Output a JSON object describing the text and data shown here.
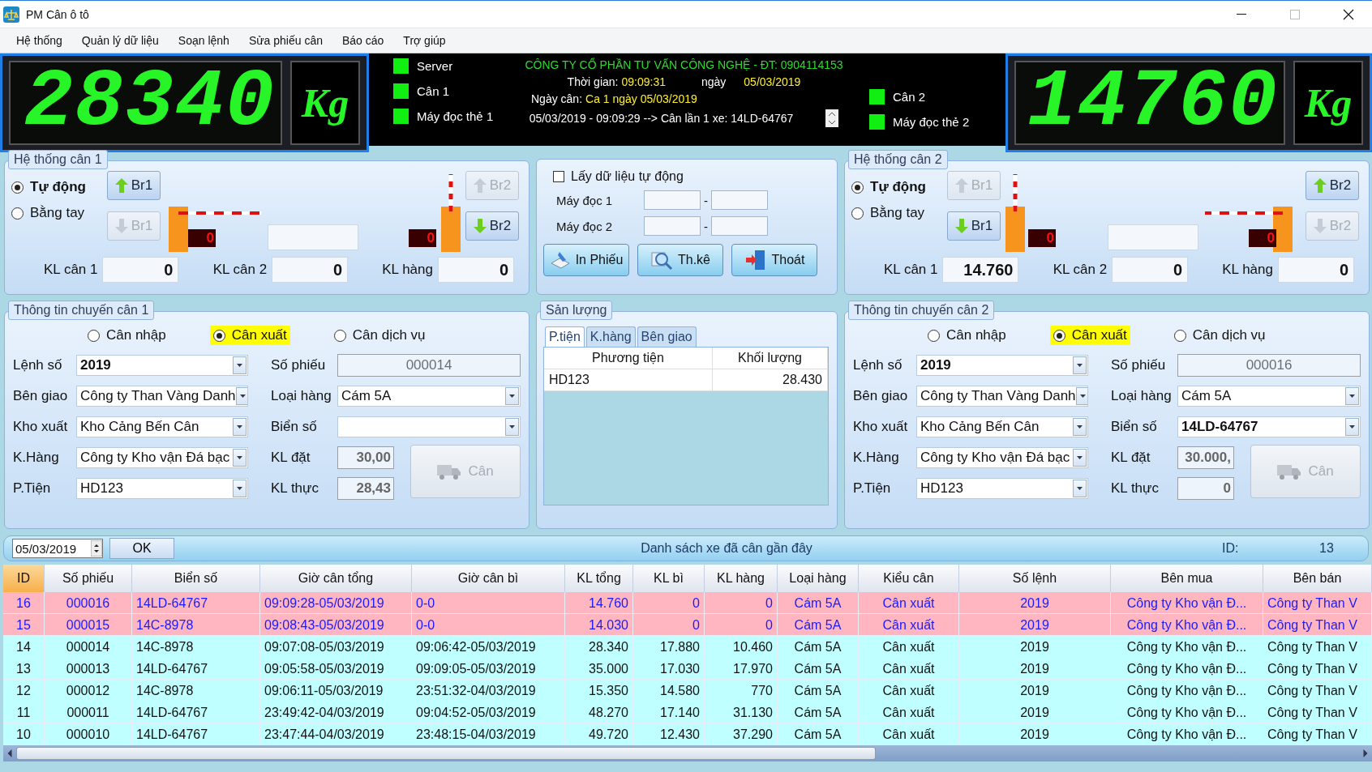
{
  "window": {
    "title": "PM Cân ô tô"
  },
  "menu": [
    {
      "label": "Hệ thống"
    },
    {
      "label": "Quản lý dữ liệu"
    },
    {
      "label": "Soạn lệnh"
    },
    {
      "label": "Sửa phiếu cân"
    },
    {
      "label": "Báo cáo"
    },
    {
      "label": "Trợ giúp"
    }
  ],
  "displays": [
    {
      "reading": "28340",
      "unit": "Kg"
    },
    {
      "reading": "14760",
      "unit": "Kg"
    }
  ],
  "status": {
    "indicators": [
      {
        "label": "Server",
        "on": true
      },
      {
        "label": "Cân 1",
        "on": true
      },
      {
        "label": "Máy đọc thẻ 1",
        "on": true
      },
      {
        "label": "Cân 2",
        "on": true
      },
      {
        "label": "Máy đọc thẻ 2",
        "on": true
      }
    ],
    "company": "CÔNG TY CỔ PHẦN TƯ VẤN CÔNG NGHỆ - ĐT: 0904114153",
    "time": {
      "label": "Thời gian:",
      "value": "09:09:31"
    },
    "day": {
      "label": "ngày",
      "value": "05/03/2019"
    },
    "weigh_date": {
      "label": "Ngày cân:",
      "value": "Ca 1 ngày 05/03/2019"
    },
    "log": "05/03/2019 - 09:09:29 --> Cân lần 1 xe: 14LD-64767"
  },
  "scales": [
    {
      "title": "Hệ thống cân 1",
      "modes": [
        {
          "label": "Tự động",
          "selected": true
        },
        {
          "label": "Bằng tay",
          "selected": false
        }
      ],
      "gates": [
        {
          "buttons": [
            {
              "label": "Br1",
              "kind": "up",
              "disabled": false
            },
            {
              "label": "Br1",
              "kind": "down",
              "disabled": true
            }
          ],
          "open": false,
          "counter": "0"
        },
        {
          "buttons": [
            {
              "label": "Br2",
              "kind": "up",
              "disabled": true
            },
            {
              "label": "Br2",
              "kind": "down",
              "disabled": false
            }
          ],
          "open": true,
          "counter": "0"
        }
      ],
      "weights": [
        {
          "label": "KL cân 1",
          "value": "0"
        },
        {
          "label": "KL cân 2",
          "value": "0"
        },
        {
          "label": "KL hàng",
          "value": "0"
        }
      ]
    },
    {
      "title": "Hệ thống cân 2",
      "modes": [
        {
          "label": "Tự động",
          "selected": true
        },
        {
          "label": "Bằng tay",
          "selected": false
        }
      ],
      "gates": [
        {
          "buttons": [
            {
              "label": "Br1",
              "kind": "up",
              "disabled": true
            },
            {
              "label": "Br1",
              "kind": "down",
              "disabled": false
            }
          ],
          "open": true,
          "counter": "0"
        },
        {
          "buttons": [
            {
              "label": "Br2",
              "kind": "up",
              "disabled": false
            },
            {
              "label": "Br2",
              "kind": "down",
              "disabled": true
            }
          ],
          "open": false,
          "counter": "0"
        }
      ],
      "weights": [
        {
          "label": "KL cân 1",
          "value": "14.760"
        },
        {
          "label": "KL cân 2",
          "value": "0"
        },
        {
          "label": "KL hàng",
          "value": "0"
        }
      ]
    }
  ],
  "reader_box": {
    "auto": {
      "label": "Lấy dữ liệu tự động",
      "checked": false
    },
    "readers": [
      {
        "label": "Máy đọc 1",
        "separator": "-"
      },
      {
        "label": "Máy đọc 2",
        "separator": "-"
      }
    ],
    "actions": [
      {
        "label": "In Phiếu",
        "kind": "print"
      },
      {
        "label": "Th.kê",
        "kind": "stats"
      },
      {
        "label": "Thoát",
        "kind": "exit"
      }
    ]
  },
  "output": {
    "title": "Sản lượng",
    "tabs": [
      {
        "label": "P.tiện",
        "selected": true
      },
      {
        "label": "K.hàng",
        "selected": false
      },
      {
        "label": "Bên giao",
        "selected": false
      }
    ],
    "columns": [
      "Phương tiện",
      "Khối lượng"
    ],
    "rows": [
      [
        "HD123",
        "28.430"
      ]
    ]
  },
  "trips": [
    {
      "title": "Thông tin chuyến cân 1",
      "types": [
        {
          "label": "Cân nhập",
          "selected": false
        },
        {
          "label": "Cân xuất",
          "selected": true
        },
        {
          "label": "Cân dịch vụ",
          "selected": false
        }
      ],
      "left_fields": [
        {
          "label": "Lệnh số",
          "value": "2019"
        },
        {
          "label": "Bên giao",
          "value": "Công ty Than Vàng Danh"
        },
        {
          "label": "Kho xuất",
          "value": "Kho Cảng Bến Cân"
        },
        {
          "label": "K.Hàng",
          "value": "Công ty Kho vận Đá bạc"
        },
        {
          "label": "P.Tiện",
          "value": "HD123"
        }
      ],
      "right_fields": [
        {
          "label": "Số phiếu",
          "value": "000014",
          "kind": "readonly"
        },
        {
          "label": "Loại hàng",
          "value": "Cám 5A",
          "kind": "combo"
        },
        {
          "label": "Biển số",
          "kind": "combo"
        },
        {
          "label": "KL đặt",
          "value": "30,00",
          "kind": "number"
        },
        {
          "label": "KL thực",
          "value": "28,43",
          "kind": "number"
        }
      ],
      "weigh_button": {
        "label": "Cân",
        "disabled": true
      }
    },
    {
      "title": "Thông tin chuyến cân 2",
      "types": [
        {
          "label": "Cân nhập",
          "selected": false
        },
        {
          "label": "Cân xuất",
          "selected": true
        },
        {
          "label": "Cân dịch vụ",
          "selected": false
        }
      ],
      "left_fields": [
        {
          "label": "Lệnh số",
          "value": "2019"
        },
        {
          "label": "Bên giao",
          "value": "Công ty Than Vàng Danh"
        },
        {
          "label": "Kho xuất",
          "value": "Kho Cảng Bến Cân"
        },
        {
          "label": "K.Hàng",
          "value": "Công ty Kho vận Đá bạc"
        },
        {
          "label": "P.Tiện",
          "value": "HD123"
        }
      ],
      "right_fields": [
        {
          "label": "Số phiếu",
          "value": "000016",
          "kind": "readonly"
        },
        {
          "label": "Loại hàng",
          "value": "Cám 5A",
          "kind": "combo"
        },
        {
          "label": "Biển số",
          "value": "14LD-64767",
          "kind": "combo"
        },
        {
          "label": "KL đặt",
          "value": "30.000,",
          "kind": "number"
        },
        {
          "label": "KL thực",
          "value": "0",
          "kind": "number"
        }
      ],
      "weigh_button": {
        "label": "Cân",
        "disabled": true
      }
    }
  ],
  "list_bar": {
    "date": "05/03/2019",
    "ok": "OK",
    "title": "Danh sách xe đã cân gần đây",
    "id_label": "ID:",
    "id_value": "13"
  },
  "table": {
    "columns": [
      {
        "label": "ID",
        "selected": true
      },
      {
        "label": "Số phiếu",
        "selected": false
      },
      {
        "label": "Biển số",
        "selected": false
      },
      {
        "label": "Giờ cân tổng",
        "selected": false
      },
      {
        "label": "Giờ cân bì",
        "selected": false
      },
      {
        "label": "KL tổng",
        "selected": false
      },
      {
        "label": "KL bì",
        "selected": false
      },
      {
        "label": "KL hàng",
        "selected": false
      },
      {
        "label": "Loại hàng",
        "selected": false
      },
      {
        "label": "Kiểu cân",
        "selected": false
      },
      {
        "label": "Số lệnh",
        "selected": false
      },
      {
        "label": "Bên mua",
        "selected": false
      },
      {
        "label": "Bên bán",
        "selected": false
      }
    ],
    "rows": [
      {
        "pending": true,
        "cells": [
          "16",
          "000016",
          "14LD-64767",
          "09:09:28-05/03/2019",
          "0-0",
          "14.760",
          "0",
          "0",
          "Cám 5A",
          "Cân xuất",
          "2019",
          "Công ty Kho vận Đ...",
          "Công ty Than V"
        ]
      },
      {
        "pending": true,
        "cells": [
          "15",
          "000015",
          "14C-8978",
          "09:08:43-05/03/2019",
          "0-0",
          "14.030",
          "0",
          "0",
          "Cám 5A",
          "Cân xuất",
          "2019",
          "Công ty Kho vận Đ...",
          "Công ty Than V"
        ]
      },
      {
        "pending": false,
        "cells": [
          "14",
          "000014",
          "14C-8978",
          "09:07:08-05/03/2019",
          "09:06:42-05/03/2019",
          "28.340",
          "17.880",
          "10.460",
          "Cám 5A",
          "Cân xuất",
          "2019",
          "Công ty Kho vận Đ...",
          "Công ty Than V"
        ]
      },
      {
        "pending": false,
        "cells": [
          "13",
          "000013",
          "14LD-64767",
          "09:05:58-05/03/2019",
          "09:09:05-05/03/2019",
          "35.000",
          "17.030",
          "17.970",
          "Cám 5A",
          "Cân xuất",
          "2019",
          "Công ty Kho vận Đ...",
          "Công ty Than V"
        ]
      },
      {
        "pending": false,
        "cells": [
          "12",
          "000012",
          "14C-8978",
          "09:06:11-05/03/2019",
          "23:51:32-04/03/2019",
          "15.350",
          "14.580",
          "770",
          "Cám 5A",
          "Cân xuất",
          "2019",
          "Công ty Kho vận Đ...",
          "Công ty Than V"
        ]
      },
      {
        "pending": false,
        "cells": [
          "11",
          "000011",
          "14LD-64767",
          "23:49:42-04/03/2019",
          "09:04:52-05/03/2019",
          "48.270",
          "17.140",
          "31.130",
          "Cám 5A",
          "Cân xuất",
          "2019",
          "Công ty Kho vận Đ...",
          "Công ty Than V"
        ]
      },
      {
        "pending": false,
        "cells": [
          "10",
          "000010",
          "14LD-64767",
          "23:47:44-04/03/2019",
          "23:48:15-04/03/2019",
          "49.720",
          "12.430",
          "37.290",
          "Cám 5A",
          "Cân xuất",
          "2019",
          "Công ty Kho vận Đ...",
          "Công ty Than V"
        ]
      }
    ]
  }
}
